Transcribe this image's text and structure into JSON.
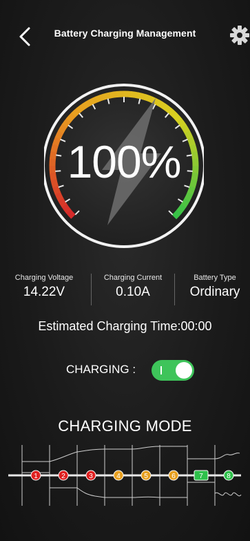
{
  "header": {
    "title": "Battery Charging Management",
    "back_icon": "chevron-left-icon",
    "settings_icon": "gear-icon"
  },
  "gauge": {
    "percent_text": "100%",
    "level": 1.0,
    "icon": "lightning-bolt-icon",
    "ring_colors": [
      "#d42a2a",
      "#e8a020",
      "#d9d020",
      "#2ec04a"
    ]
  },
  "stats": [
    {
      "label": "Charging Voltage",
      "value": "14.22V"
    },
    {
      "label": "Charging Current",
      "value": "0.10A"
    },
    {
      "label": "Battery Type",
      "value": "Ordinary"
    }
  ],
  "estimated": {
    "text": "Estimated Charging Time:00:00"
  },
  "charging": {
    "label": "CHARGING :",
    "toggle_on": true,
    "toggle_color": "#3ec45a"
  },
  "mode": {
    "title": "CHARGING MODE",
    "steps": [
      {
        "label": "1",
        "color": "#e02020"
      },
      {
        "label": "2",
        "color": "#e02020"
      },
      {
        "label": "3",
        "color": "#e02020"
      },
      {
        "label": "4",
        "color": "#e8a020"
      },
      {
        "label": "5",
        "color": "#e8a020"
      },
      {
        "label": "6",
        "color": "#e8a020"
      },
      {
        "label": "7",
        "color": "#2ec04a"
      },
      {
        "label": "8",
        "color": "#2ec04a"
      }
    ]
  }
}
